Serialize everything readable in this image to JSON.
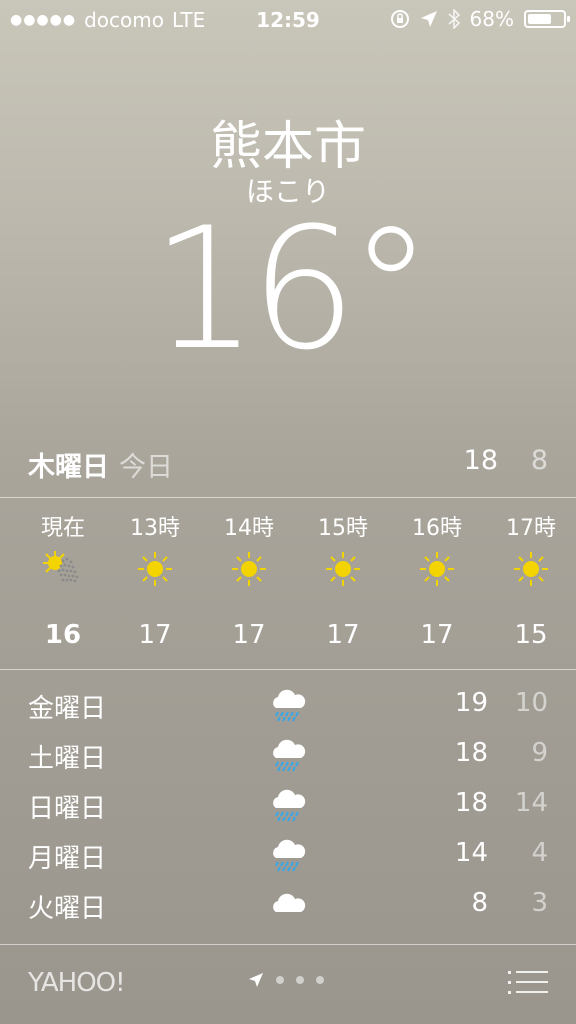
{
  "status_bar": {
    "carrier": "docomo",
    "network": "LTE",
    "time": "12:59",
    "battery": "68%",
    "battery_level": 0.68
  },
  "location": {
    "city": "熊本市",
    "condition": "ほこり",
    "temperature": "16°"
  },
  "today": {
    "day": "木曜日",
    "label": "今日",
    "high": "18",
    "low": "8"
  },
  "hourly": [
    {
      "label": "現在",
      "icon": "partly-sunny-dust-icon",
      "temp": "16"
    },
    {
      "label": "13時",
      "icon": "sun-icon",
      "temp": "17"
    },
    {
      "label": "14時",
      "icon": "sun-icon",
      "temp": "17"
    },
    {
      "label": "15時",
      "icon": "sun-icon",
      "temp": "17"
    },
    {
      "label": "16時",
      "icon": "sun-icon",
      "temp": "17"
    },
    {
      "label": "17時",
      "icon": "sun-icon",
      "temp": "15"
    }
  ],
  "daily": [
    {
      "day": "金曜日",
      "icon": "rain-cloud-icon",
      "high": "19",
      "low": "10"
    },
    {
      "day": "土曜日",
      "icon": "rain-cloud-icon",
      "high": "18",
      "low": "9"
    },
    {
      "day": "日曜日",
      "icon": "rain-cloud-icon",
      "high": "18",
      "low": "14"
    },
    {
      "day": "月曜日",
      "icon": "rain-cloud-icon",
      "high": "14",
      "low": "4"
    },
    {
      "day": "火曜日",
      "icon": "cloud-icon",
      "high": "8",
      "low": "3"
    }
  ],
  "footer": {
    "brand": "YAHOO!"
  },
  "colors": {
    "sun": "#f4d400",
    "rain": "#3aa6e8"
  }
}
